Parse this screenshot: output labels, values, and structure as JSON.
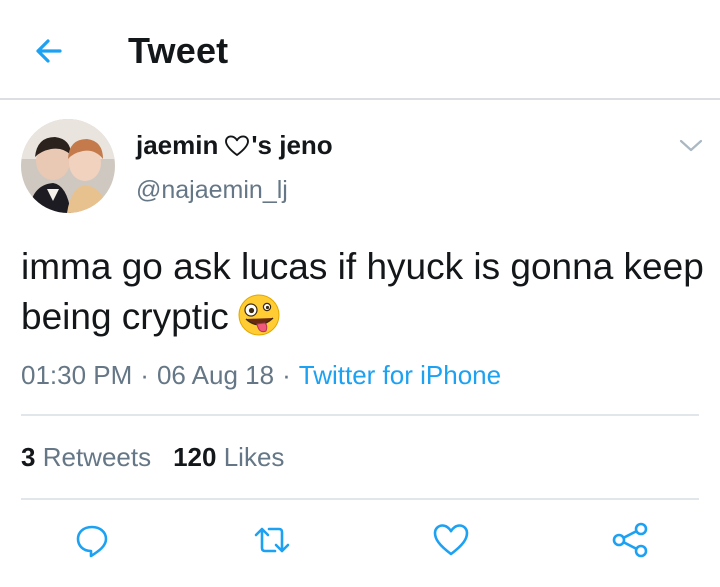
{
  "header": {
    "title": "Tweet",
    "back_icon": "arrow-left-icon",
    "accent": "#1da1f2"
  },
  "tweet": {
    "display_name_before": "jaemin",
    "display_name_after": "'s jeno",
    "username": "@najaemin_lj",
    "text": "imma go ask lucas if hyuck is gonna keep being cryptic",
    "emoji": "zany-face-emoji",
    "time": "01:30 PM",
    "date": "06 Aug 18",
    "source": "Twitter for iPhone",
    "separator": "·"
  },
  "stats": {
    "retweets_count": "3",
    "retweets_label": "Retweets",
    "likes_count": "120",
    "likes_label": "Likes"
  },
  "actions": [
    "reply-icon",
    "retweet-icon",
    "like-icon",
    "share-icon"
  ],
  "colors": {
    "text": "#14171a",
    "secondary": "#657786",
    "link": "#1da1f2",
    "divider": "#e1e6ea"
  }
}
